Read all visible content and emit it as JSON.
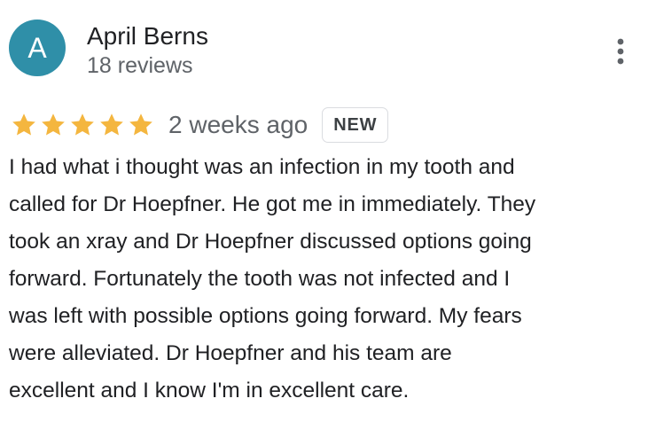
{
  "reviewer": {
    "avatar_initial": "A",
    "avatar_color": "#2f8fa8",
    "name": "April Berns",
    "review_count": "18 reviews"
  },
  "menu": {
    "icon": "more-vert-icon"
  },
  "review": {
    "rating": 5,
    "max_rating": 5,
    "star_color": "#f4b63f",
    "time_ago": "2 weeks ago",
    "badge": "NEW",
    "text": "I had what i thought was an infection in my tooth and\ncalled for Dr Hoepfner. He got me in immediately. They\ntook an xray and Dr Hoepfner discussed options going\nforward. Fortunately the tooth was not infected and I\nwas left with possible options going forward. My fears\nwere alleviated. Dr Hoepfner and his team are\nexcellent and I know I'm in excellent care."
  }
}
